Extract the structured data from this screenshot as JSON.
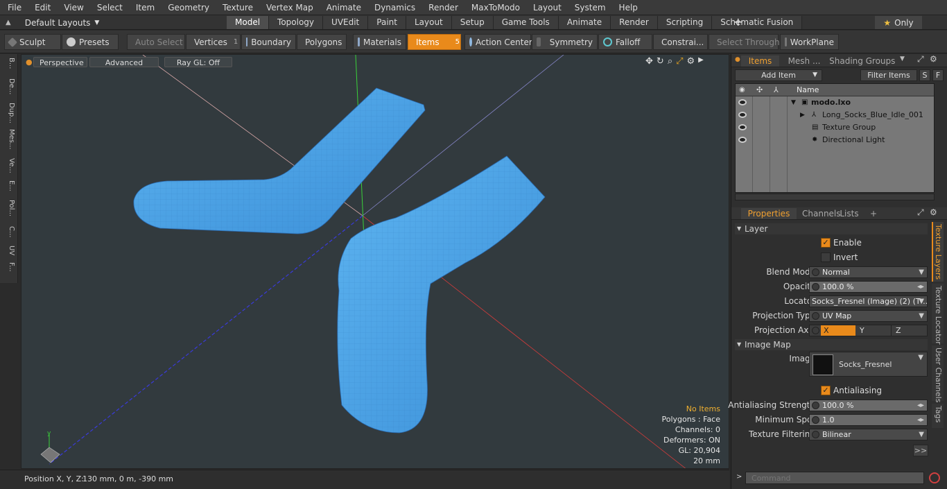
{
  "menu": [
    "File",
    "Edit",
    "View",
    "Select",
    "Item",
    "Geometry",
    "Texture",
    "Vertex Map",
    "Animate",
    "Dynamics",
    "Render",
    "MaxToModo",
    "Layout",
    "System",
    "Help"
  ],
  "layout": {
    "label": "Default Layouts",
    "tabs": [
      "Model",
      "Topology",
      "UVEdit",
      "Paint",
      "Layout",
      "Setup",
      "Game Tools",
      "Animate",
      "Render",
      "Scripting",
      "Schematic Fusion"
    ],
    "active_tab": "Model",
    "only_label": "Only"
  },
  "toolbar": {
    "sculpt": "Sculpt",
    "presets": "Presets",
    "auto_select": "Auto Select",
    "vertices": "Vertices",
    "vertices_count": "1",
    "boundary": "Boundary",
    "polygons": "Polygons",
    "materials": "Materials",
    "items": "Items",
    "items_count": "5",
    "action_center": "Action Center",
    "symmetry": "Symmetry",
    "falloff": "Falloff",
    "constraints": "Constrai...",
    "select_through": "Select Through",
    "workplane": "WorkPlane"
  },
  "left_tabs": [
    "B...",
    "De...",
    "Dup...",
    "Mes...",
    "Ve...",
    "E...",
    "Pol...",
    "C...",
    "UV",
    "F..."
  ],
  "viewport": {
    "perspective": "Perspective",
    "advanced": "Advanced",
    "raygl": "Ray GL: Off",
    "hud": {
      "no_items": "No Items",
      "polygons": "Polygons : Face",
      "channels": "Channels: 0",
      "deformers": "Deformers: ON",
      "gl": "GL: 20,904",
      "scale": "20 mm"
    }
  },
  "status": {
    "position_label": "Position X, Y, Z:",
    "position_value": "130 mm, 0 m, -390 mm"
  },
  "items_panel": {
    "tabs": [
      "Items",
      "Mesh ...",
      "Shading",
      "Groups"
    ],
    "active_tab": "Items",
    "add_item": "Add Item",
    "filter_items": "Filter Items",
    "s_btn": "S",
    "f_btn": "F",
    "name_header": "Name",
    "rows": [
      {
        "label": "modo.lxo",
        "indent": 0
      },
      {
        "label": "Long_Socks_Blue_Idle_001",
        "indent": 1
      },
      {
        "label": "Texture Group",
        "indent": 1
      },
      {
        "label": "Directional Light",
        "indent": 1
      }
    ]
  },
  "props_panel": {
    "tabs": [
      "Properties",
      "Channels",
      "Lists"
    ],
    "active_tab": "Properties",
    "layer_header": "Layer",
    "enable": "Enable",
    "invert": "Invert",
    "blend_mode_label": "Blend Mode",
    "blend_mode": "Normal",
    "opacity_label": "Opacity",
    "opacity": "100.0 %",
    "locator_label": "Locator",
    "locator": "Socks_Fresnel (Image) (2) (T ...",
    "proj_type_label": "Projection Type",
    "proj_type": "UV Map",
    "proj_axis_label": "Projection Axis",
    "axis_x": "X",
    "axis_y": "Y",
    "axis_z": "Z",
    "image_map_header": "Image Map",
    "image_label": "Image",
    "image_name": "Socks_Fresnel",
    "antialiasing": "Antialiasing",
    "aa_strength_label": "Antialiasing Strength",
    "aa_strength": "100.0 %",
    "min_spot_label": "Minimum Spot",
    "min_spot": "1.0",
    "tex_filter_label": "Texture Filtering",
    "tex_filter": "Bilinear",
    "more": ">>",
    "side_tabs": [
      "Texture Layers",
      "Texture Locator",
      "User Channels",
      "Tags"
    ],
    "command_placeholder": "Command"
  }
}
